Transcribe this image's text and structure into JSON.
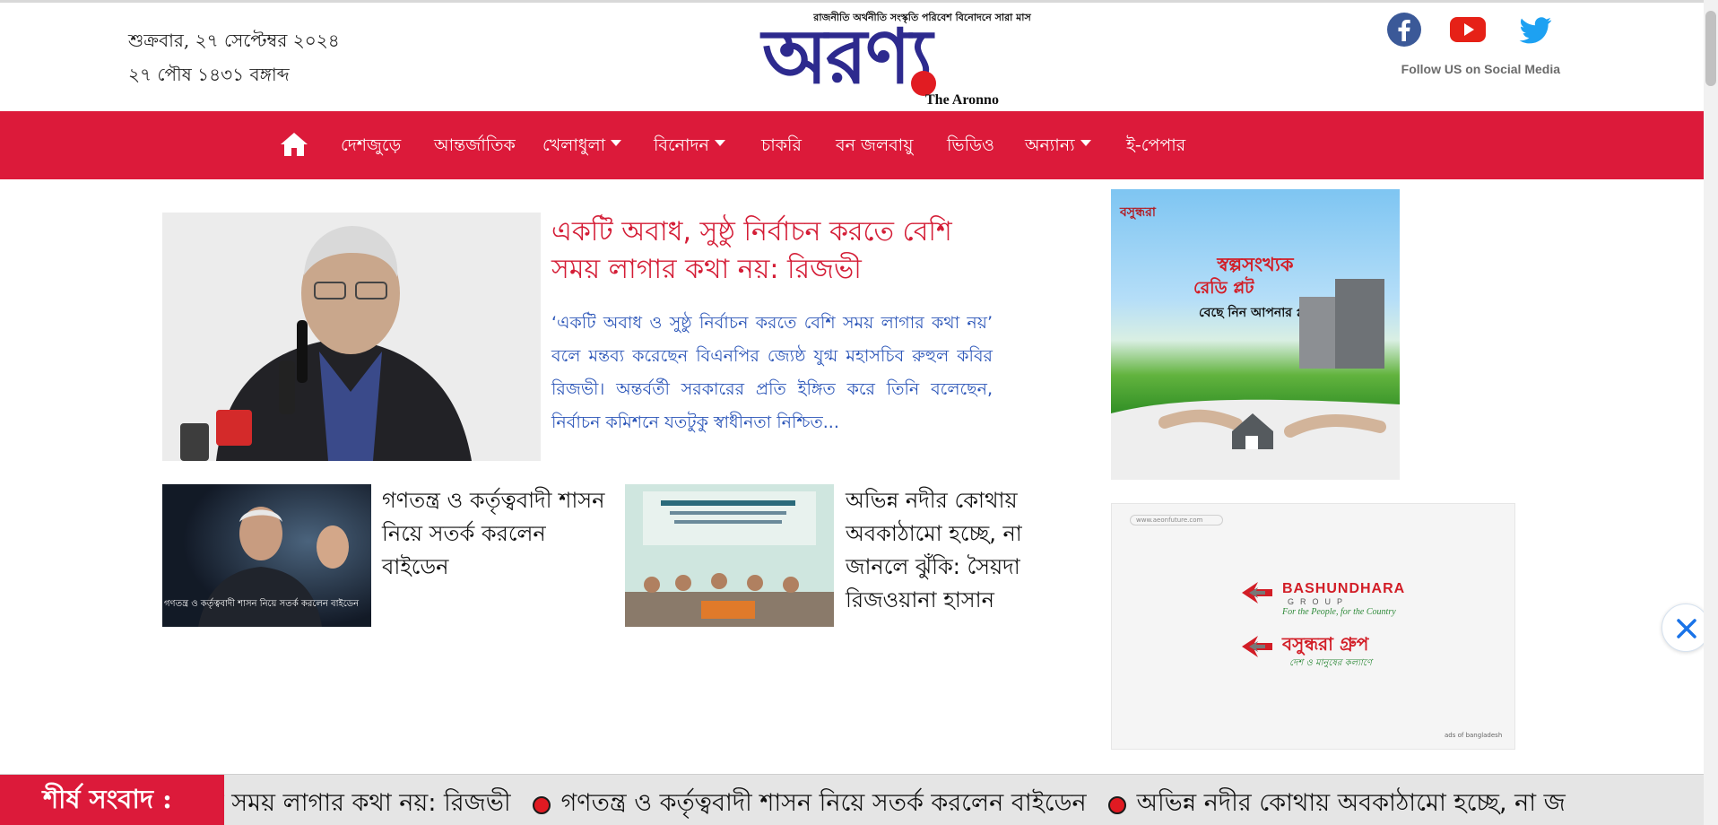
{
  "header": {
    "date_line_1": "শুক্রবার, ২৭ সেপ্টেম্বর ২০২৪",
    "date_line_2": "২৭ পৌষ ১৪৩১ বঙ্গাব্দ",
    "logo_tagline": "রাজনীতি অর্থনীতি সংস্কৃতি পরিবেশ বিনোদনে সারা মাস",
    "logo_text": "অরণ্য",
    "logo_subtitle": "The Aronno",
    "follow_text": "Follow US on Social Media",
    "social_icons": [
      "facebook-icon",
      "youtube-icon",
      "twitter-icon"
    ]
  },
  "nav": {
    "items": [
      {
        "label": "দেশজুড়ে",
        "dropdown": false
      },
      {
        "label": "আন্তর্জাতিক",
        "dropdown": false
      },
      {
        "label": "খেলাধুলা",
        "dropdown": true
      },
      {
        "label": "বিনোদন",
        "dropdown": true
      },
      {
        "label": "চাকরি",
        "dropdown": false
      },
      {
        "label": "বন জলবায়ু",
        "dropdown": false
      },
      {
        "label": "ভিডিও",
        "dropdown": false
      },
      {
        "label": "অন্যান্য",
        "dropdown": true
      },
      {
        "label": "ই-পেপার",
        "dropdown": false
      }
    ]
  },
  "lead": {
    "title": "একটি অবাধ, সুষ্ঠু নির্বাচন করতে বেশি সময় লাগার কথা নয়: রিজভী",
    "summary": "‘একটি অবাধ ও সুষ্ঠু নির্বাচন করতে বেশি সময় লাগার কথা নয়’ বলে মন্তব্য করেছেন বিএনপির জ্যেষ্ঠ যুগ্ম মহাসচিব রুহুল কবির রিজভী। অন্তর্বর্তী সরকারের প্রতি ইঙ্গিত করে তিনি বলেছেন, নির্বাচন কমিশনে যতটুকু স্বাধীনতা নিশ্চিত..."
  },
  "sub_stories": [
    {
      "title": "গণতন্ত্র ও কর্তৃত্ববাদী শাসন নিয়ে সতর্ক করলেন বাইডেন",
      "image_caption": "গণতন্ত্র ও কর্তৃত্ববাদী শাসন নিয়ে সতর্ক করলেন বাইডেন"
    },
    {
      "title": "অভিন্ন নদীর কোথায় অবকাঠামো হচ্ছে, না জানলে ঝুঁকি: সৈয়দা রিজওয়ানা হাসান"
    }
  ],
  "ads": {
    "ad1": {
      "brand": "বসুন্ধরা",
      "line1": "স্বল্পসংখ্যক",
      "line2": "রেডি প্লট",
      "line3": "বেছে নিন আপনার প্লট"
    },
    "ad2": {
      "url_text": "www.aeonfuture.com",
      "name_en": "BASHUNDHARA",
      "group_en": "GROUP",
      "tagline_en": "For the People, for the Country",
      "name_bn": "বসুন্ধরা গ্রুপ",
      "tagline_bn": "দেশ ও মানুষের কল্যাণে",
      "footer": "ads of bangladesh"
    }
  },
  "ticker": {
    "label": "শীর্ষ সংবাদ :",
    "items": [
      "শি সময় লাগার কথা নয়: রিজভী",
      "গণতন্ত্র ও কর্তৃত্ববাদী শাসন নিয়ে সতর্ক করলেন বাইডেন",
      "অভিন্ন নদীর কোথায় অবকাঠামো হচ্ছে, না জ"
    ]
  },
  "colors": {
    "nav_bg": "#dc1a3a",
    "lead_title": "#d41d36",
    "lead_summary": "#2b55b8",
    "logo_blue": "#2d2a8e",
    "logo_red_dot": "#e11c22"
  }
}
